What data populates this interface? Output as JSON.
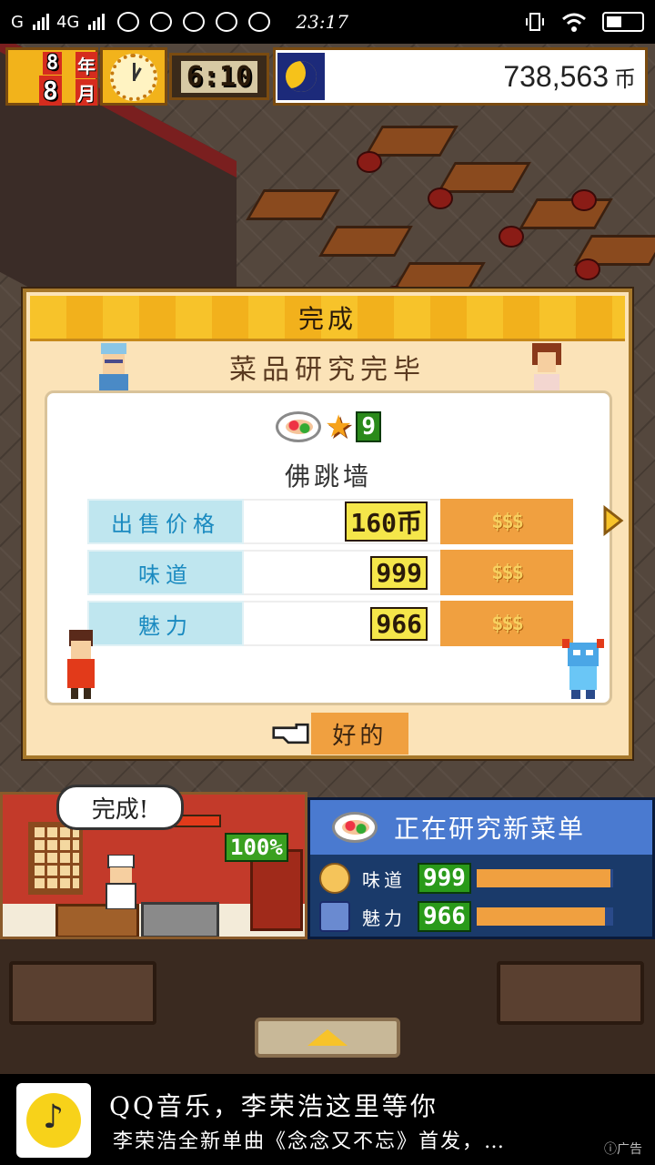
{
  "status_bar": {
    "carrier_1": "G",
    "carrier_2": "4G",
    "time": "23:17"
  },
  "hud": {
    "year_num": "8",
    "year_label": "年",
    "month_num": "8",
    "month_label": "月",
    "time": "6:10",
    "money": "738,563",
    "money_unit": "币"
  },
  "dialog": {
    "title": "完成",
    "subtitle": "菜品研究完毕",
    "rank": "9",
    "dish_name": "佛跳墙",
    "stats": [
      {
        "label": "出售价格",
        "value": "160币",
        "coins": "$$$"
      },
      {
        "label": "味道",
        "value": "999",
        "coins": "$$$"
      },
      {
        "label": "魅力",
        "value": "966",
        "coins": "$$$"
      }
    ],
    "ok_label": "好的"
  },
  "research": {
    "bubble": "完成!",
    "progress_text": "100%",
    "progress_fraction": 1.0,
    "title": "正在研究新菜单",
    "taste_label": "味道",
    "taste_value": "999",
    "taste_fraction": 0.98,
    "charm_label": "魅力",
    "charm_value": "966",
    "charm_fraction": 0.94
  },
  "ad": {
    "title": "QQ音乐，李荣浩这里等你",
    "desc": "李荣浩全新单曲《念念又不忘》首发，…",
    "tag": "广告"
  },
  "colors": {
    "gold": "#f7c32a",
    "orange": "#f0a040",
    "panel_blue": "#4a7ad0",
    "label_blue": "#bfe6ef"
  }
}
